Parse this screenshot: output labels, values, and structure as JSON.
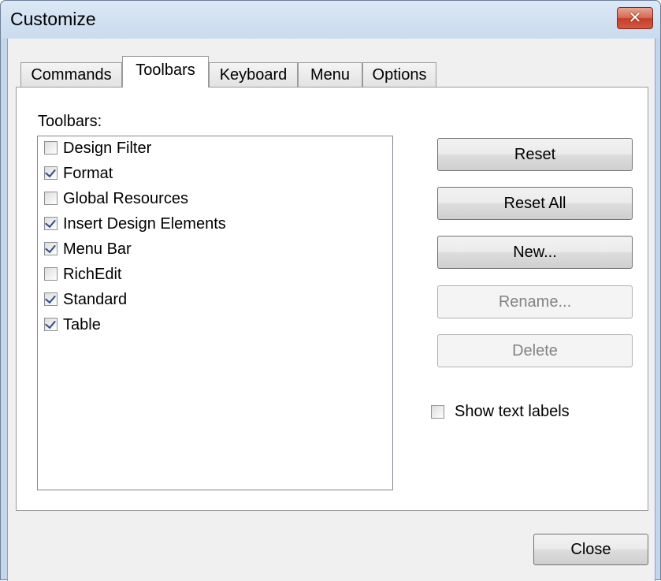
{
  "window": {
    "title": "Customize",
    "close_glyph": "✕"
  },
  "tabs": [
    {
      "label": "Commands",
      "active": false
    },
    {
      "label": "Toolbars",
      "active": true
    },
    {
      "label": "Keyboard",
      "active": false
    },
    {
      "label": "Menu",
      "active": false
    },
    {
      "label": "Options",
      "active": false
    }
  ],
  "toolbars_panel": {
    "list_label": "Toolbars:",
    "items": [
      {
        "label": "Design Filter",
        "checked": false
      },
      {
        "label": "Format",
        "checked": true
      },
      {
        "label": "Global Resources",
        "checked": false
      },
      {
        "label": "Insert Design Elements",
        "checked": true
      },
      {
        "label": "Menu Bar",
        "checked": true
      },
      {
        "label": "RichEdit",
        "checked": false
      },
      {
        "label": "Standard",
        "checked": true
      },
      {
        "label": "Table",
        "checked": true
      }
    ],
    "buttons": {
      "reset": "Reset",
      "reset_all": "Reset All",
      "new": "New...",
      "rename": "Rename...",
      "delete": "Delete"
    },
    "show_text_labels": {
      "label": "Show text labels",
      "checked": false
    }
  },
  "footer": {
    "close": "Close"
  },
  "colors": {
    "frame": "#c4d6ea",
    "close_button": "#c9452f",
    "checkmark": "#2f4c84"
  }
}
